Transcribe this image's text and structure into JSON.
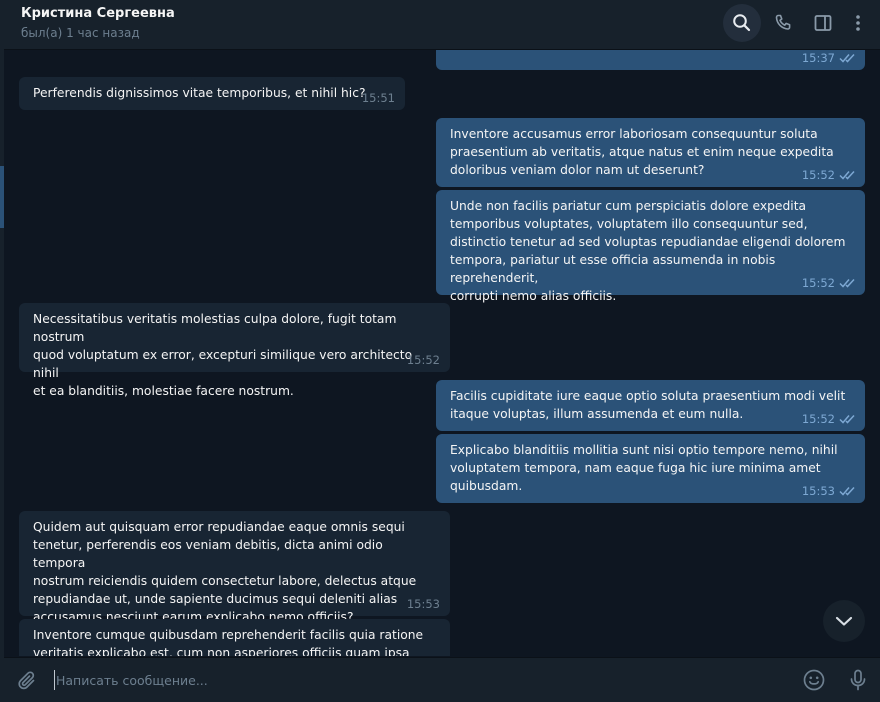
{
  "header": {
    "contact_name": "Кристина Сергеевна",
    "status": "был(а) 1 час назад",
    "icons": [
      "search-icon",
      "phone-icon",
      "sidebar-icon",
      "more-icon"
    ]
  },
  "messages": [
    {
      "dir": "out",
      "text": "",
      "time": "15:37"
    },
    {
      "dir": "in",
      "text": "Perferendis dignissimos vitae temporibus, et nihil hic?",
      "time": "15:51"
    },
    {
      "dir": "out",
      "text": "Inventore accusamus error laboriosam consequuntur soluta\npraesentium ab veritatis, atque natus et enim neque expedita\ndoloribus veniam dolor nam ut deserunt?",
      "time": "15:52"
    },
    {
      "dir": "out",
      "text": "Unde non facilis pariatur cum perspiciatis dolore expedita\ntemporibus voluptates, voluptatem illo consequuntur sed,\ndistinctio tenetur ad sed voluptas repudiandae eligendi dolorem\ntempora, pariatur ut esse officia assumenda in nobis reprehenderit,\ncorrupti nemo alias officiis.",
      "time": "15:52"
    },
    {
      "dir": "in",
      "text": "Necessitatibus veritatis molestias culpa dolore, fugit totam nostrum\nquod voluptatum ex error, excepturi similique vero architecto nihil\net ea blanditiis, molestiae facere nostrum.",
      "time": "15:52"
    },
    {
      "dir": "out",
      "text": "Facilis cupiditate iure eaque optio soluta praesentium modi velit\nitaque voluptas, illum assumenda et eum nulla.",
      "time": "15:52"
    },
    {
      "dir": "out",
      "text": "Explicabo blanditiis mollitia sunt nisi optio tempore nemo, nihil\nvoluptatem tempora, nam eaque fuga hic iure minima amet\nquibusdam.",
      "time": "15:53"
    },
    {
      "dir": "in",
      "text": "Quidem aut quisquam error repudiandae eaque omnis sequi\ntenetur, perferendis eos veniam debitis, dicta animi odio tempora\nnostrum reiciendis quidem consectetur labore, delectus atque\nrepudiandae ut, unde sapiente ducimus sequi deleniti alias\naccusamus nesciunt earum explicabo nemo officiis?",
      "time": "15:53"
    },
    {
      "dir": "in",
      "text": "Inventore cumque quibusdam reprehenderit facilis quia ratione\nveritatis explicabo est, cum non asperiores officiis quam ipsa harum",
      "time": ""
    }
  ],
  "composer": {
    "placeholder": "Написать сообщение...",
    "value": ""
  },
  "colors": {
    "background": "#0e1621",
    "panel": "#17212b",
    "incoming_bubble": "#182533",
    "outgoing_bubble": "#2b5278",
    "read_ticks": "#7da8d3"
  }
}
